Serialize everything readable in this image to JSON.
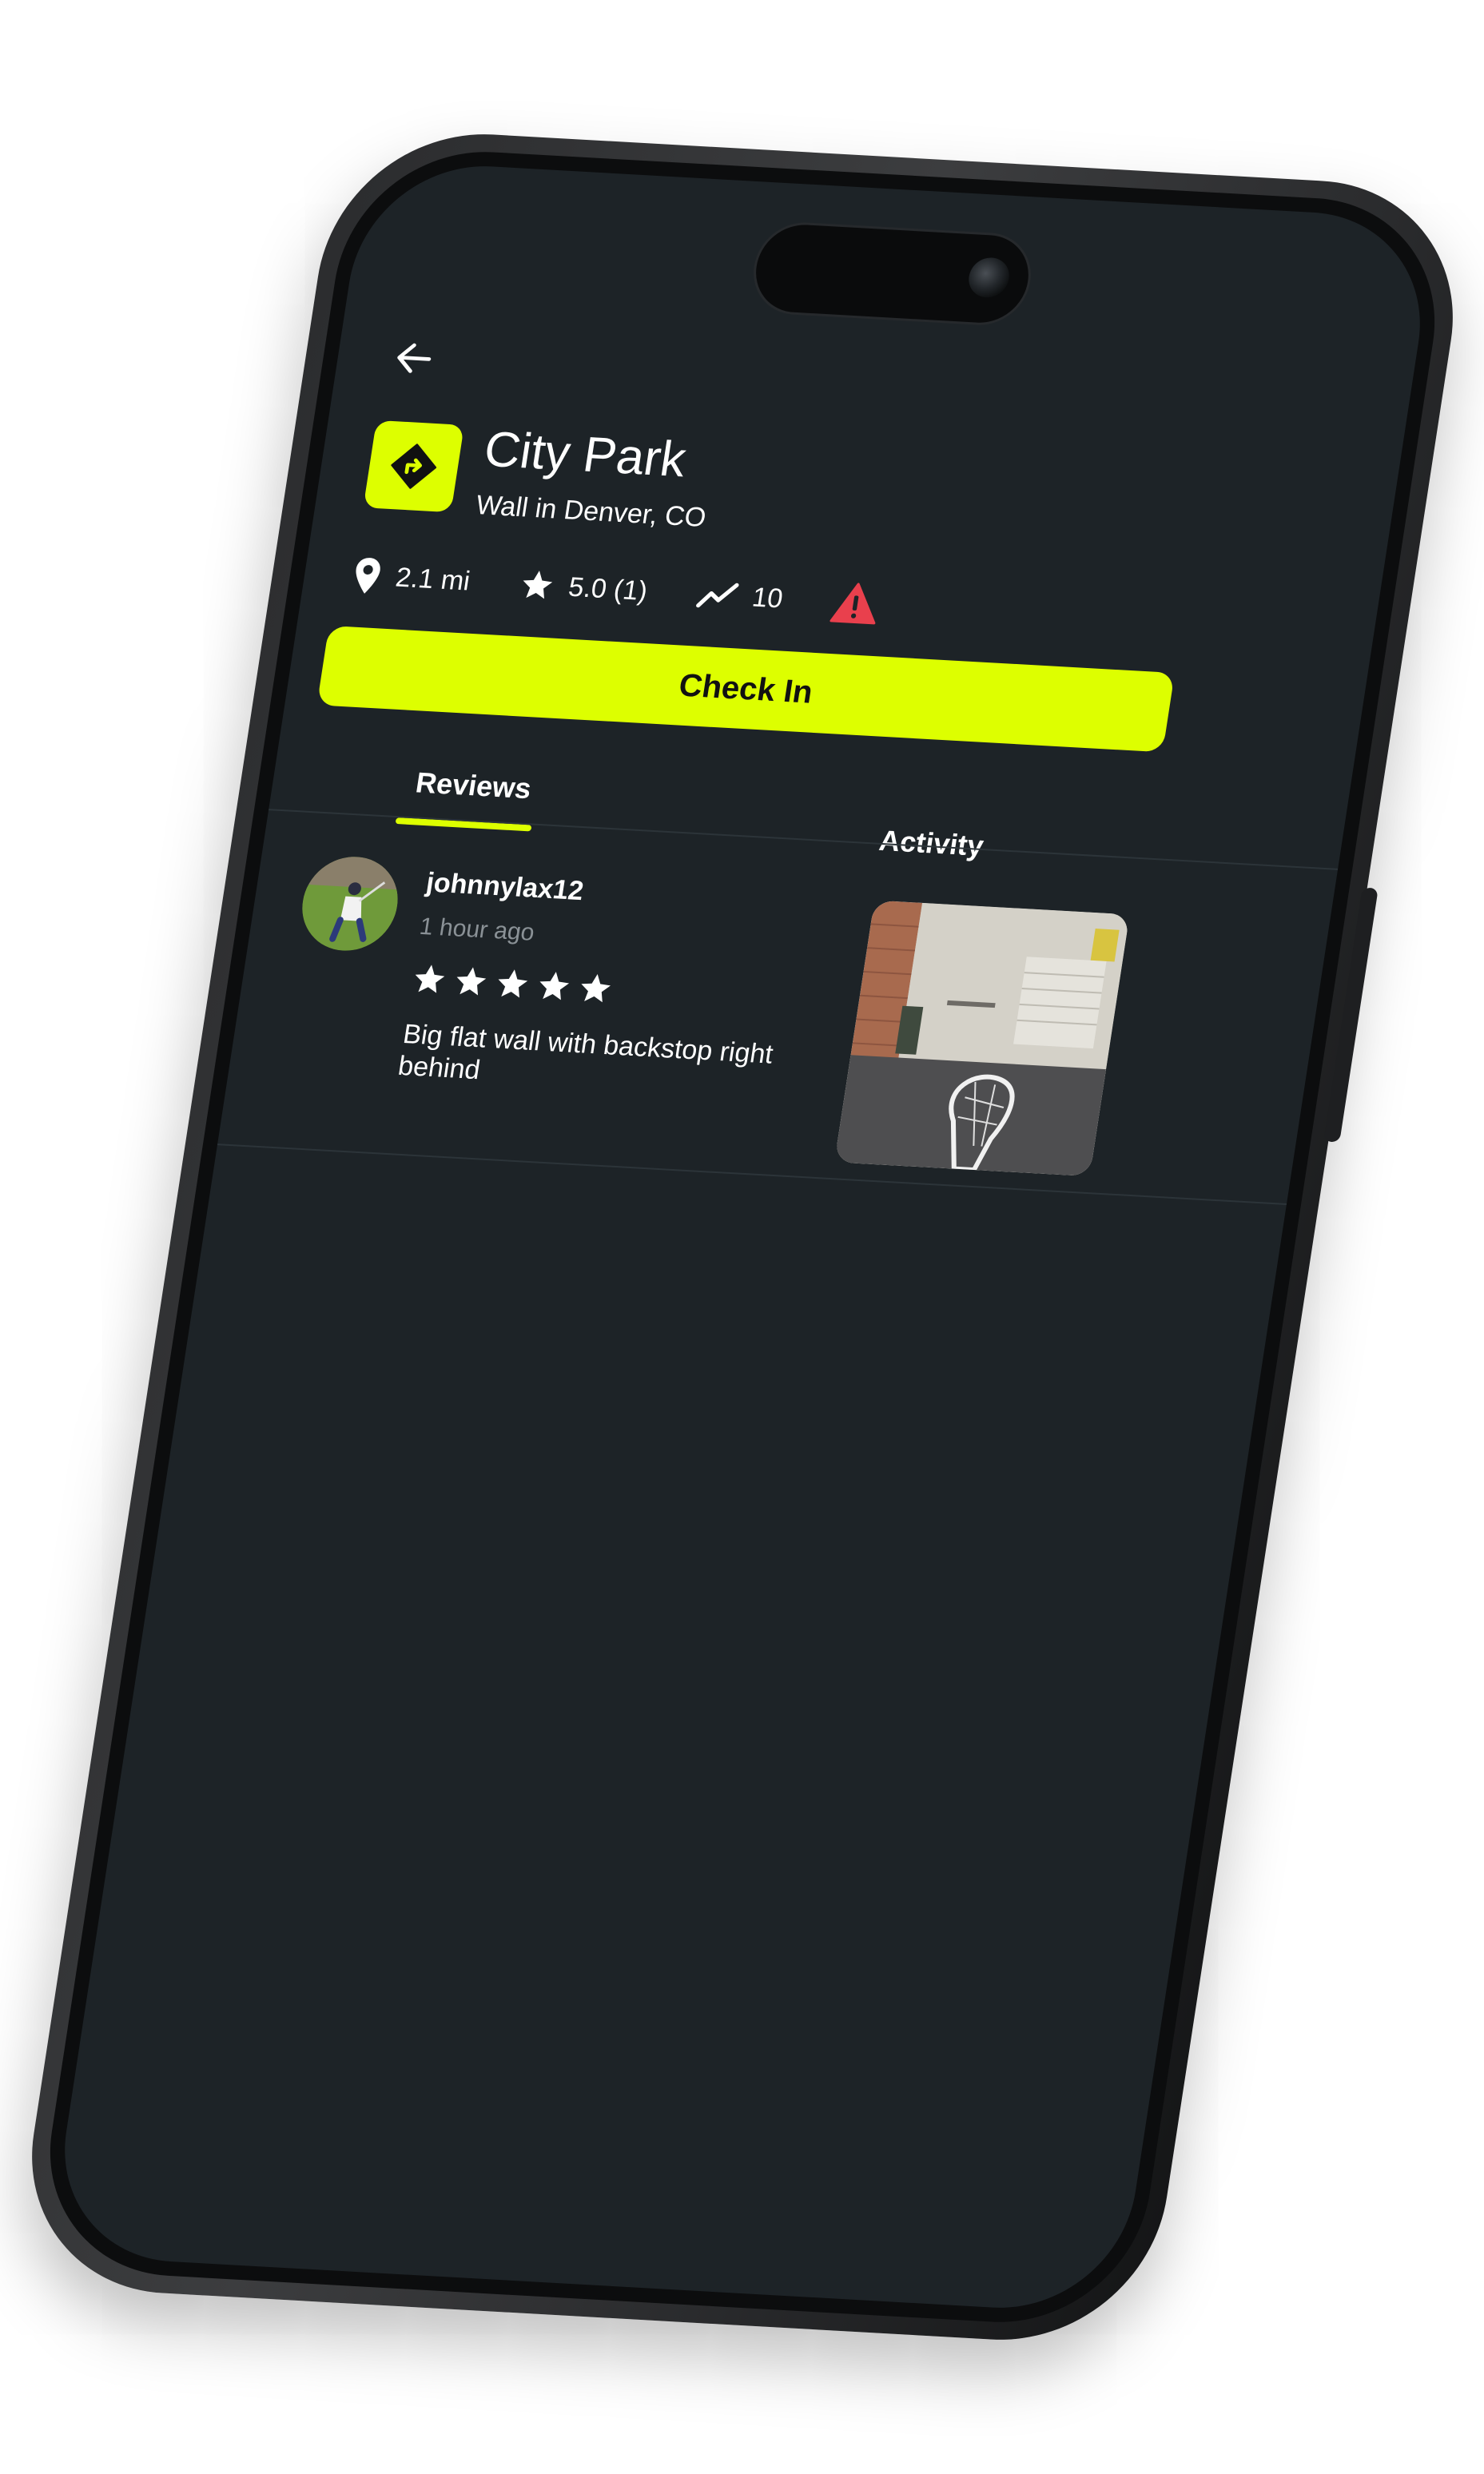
{
  "colors": {
    "accent": "#ddff00",
    "screen_bg": "#1d2327",
    "warning": "#e9404d",
    "muted_text": "#8a9196"
  },
  "header": {
    "back_icon": "arrow-left-icon",
    "spot_icon": "direction-sign-icon",
    "title": "City Park",
    "subtitle": "Wall in Denver, CO"
  },
  "meta": {
    "distance": "2.1 mi",
    "rating": "5.0 (1)",
    "activity_count": "10",
    "distance_icon": "location-pin-icon",
    "rating_icon": "star-icon",
    "activity_icon": "trend-up-icon",
    "report_icon": "warning-triangle-icon"
  },
  "actions": {
    "check_in_label": "Check In"
  },
  "tabs": [
    {
      "label": "Reviews",
      "active": true
    },
    {
      "label": "Activity",
      "active": false
    }
  ],
  "reviews": [
    {
      "user": "johnnylax12",
      "time": "1 hour ago",
      "stars": 5,
      "text": "Big flat wall with backstop right behind"
    }
  ]
}
